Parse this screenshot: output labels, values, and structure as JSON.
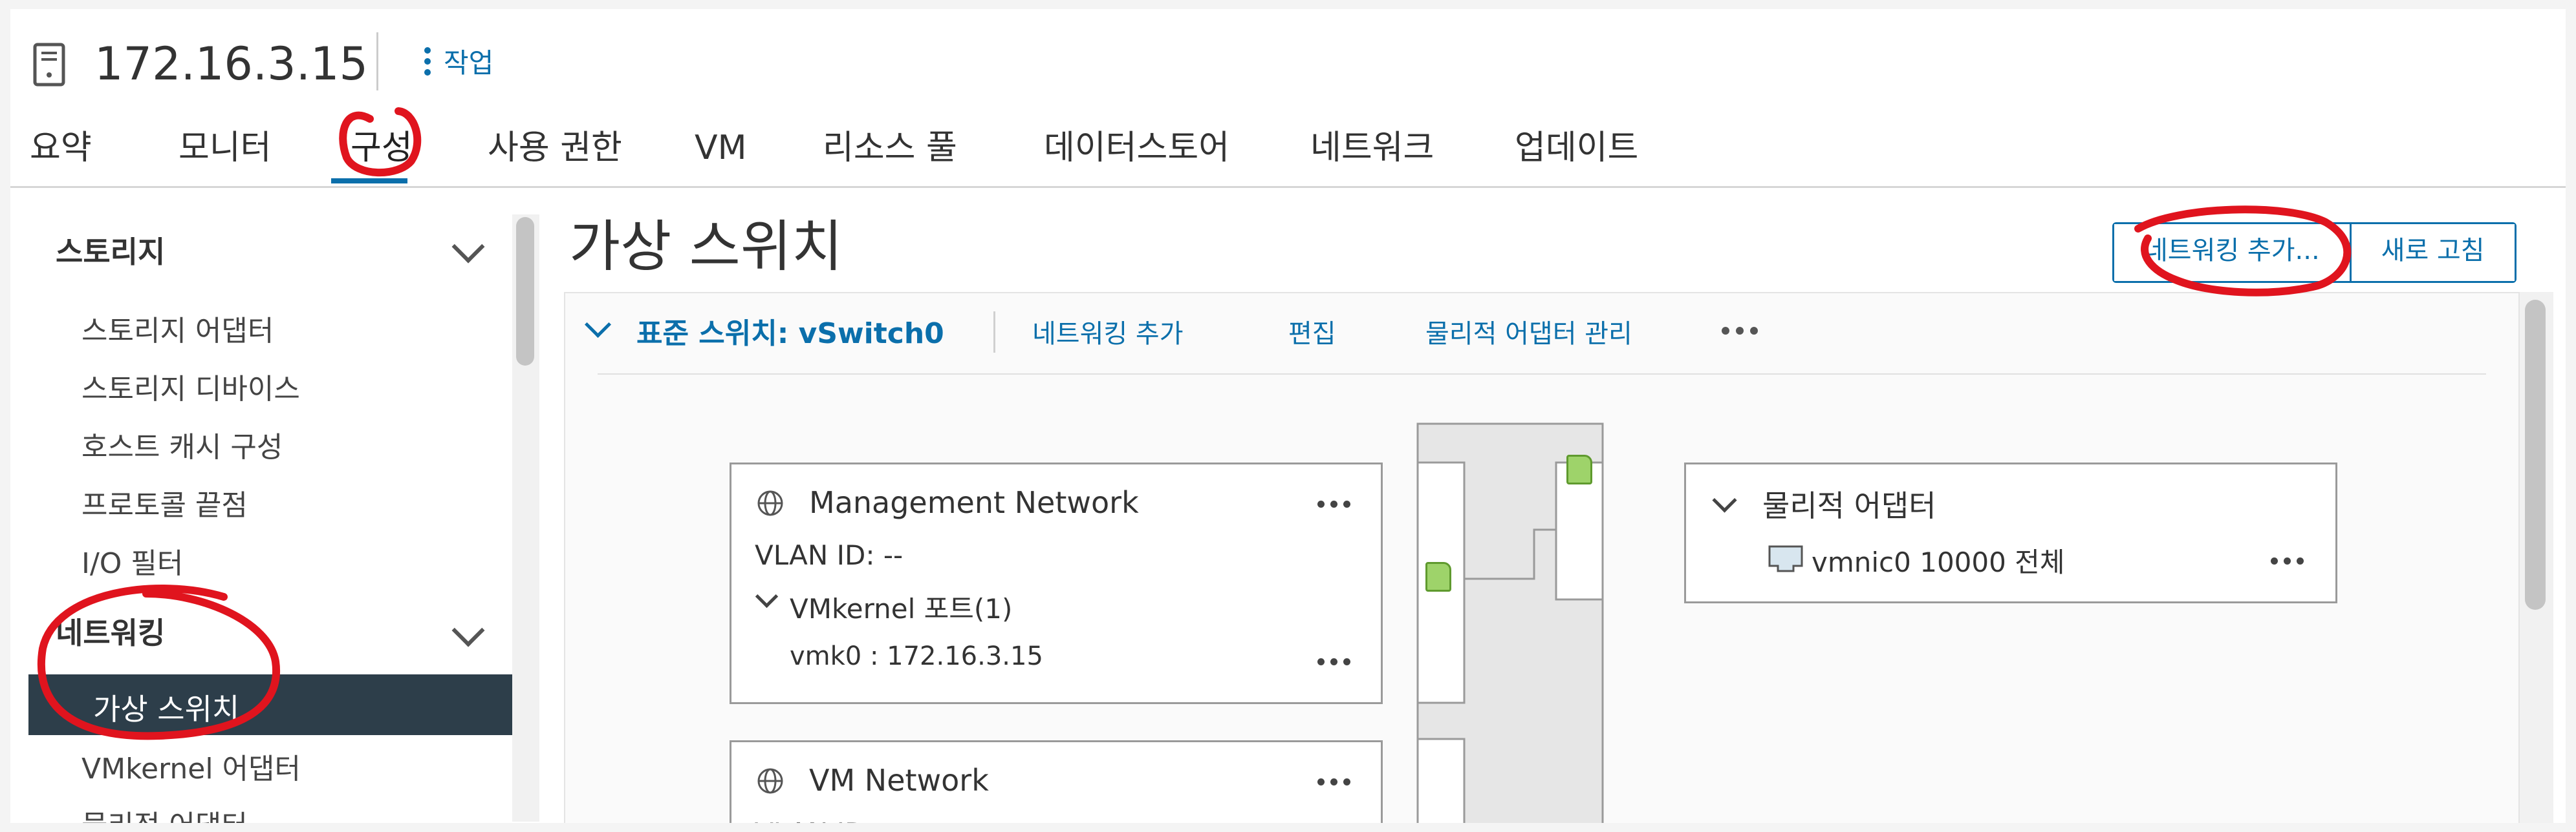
{
  "header": {
    "host_title": "172.16.3.15",
    "actions_label": "작업",
    "host_icon": "server-icon"
  },
  "tabs": [
    {
      "label": "요약"
    },
    {
      "label": "모니터"
    },
    {
      "label": "구성",
      "active": true
    },
    {
      "label": "사용 권한"
    },
    {
      "label": "VM"
    },
    {
      "label": "리소스 풀"
    },
    {
      "label": "데이터스토어"
    },
    {
      "label": "네트워크"
    },
    {
      "label": "업데이트"
    }
  ],
  "sidebar": {
    "groups": [
      {
        "label": "스토리지",
        "items": [
          {
            "label": "스토리지 어댑터"
          },
          {
            "label": "스토리지 디바이스"
          },
          {
            "label": "호스트 캐시 구성"
          },
          {
            "label": "프로토콜 끝점"
          },
          {
            "label": "I/O 필터"
          }
        ]
      },
      {
        "label": "네트워킹",
        "items": [
          {
            "label": "가상 스위치",
            "selected": true
          },
          {
            "label": "VMkernel 어댑터"
          },
          {
            "label": "물리적 어댑터"
          }
        ]
      }
    ]
  },
  "main": {
    "title": "가상 스위치",
    "buttons": {
      "add_networking": "네트워킹 추가...",
      "refresh": "새로 고침"
    },
    "switch": {
      "title": "표준 스위치: vSwitch0",
      "actions": [
        "네트워킹 추가",
        "편집",
        "물리적 어댑터 관리"
      ],
      "port_groups": [
        {
          "name": "Management Network",
          "vlan": "VLAN ID: --",
          "ports_label": "VMkernel 포트(1)",
          "port": "vmk0 : 172.16.3.15"
        },
        {
          "name": "VM Network",
          "vlan": "VLAN ID:"
        }
      ],
      "physical_adapters": {
        "title": "물리적 어댑터",
        "adapter": "vmnic0 10000 전체"
      }
    }
  },
  "colors": {
    "accent": "#0b6fab",
    "selected_nav_bg": "#2d3e4a",
    "port_green": "#9ed36a",
    "annotation_red": "#e0141e"
  }
}
